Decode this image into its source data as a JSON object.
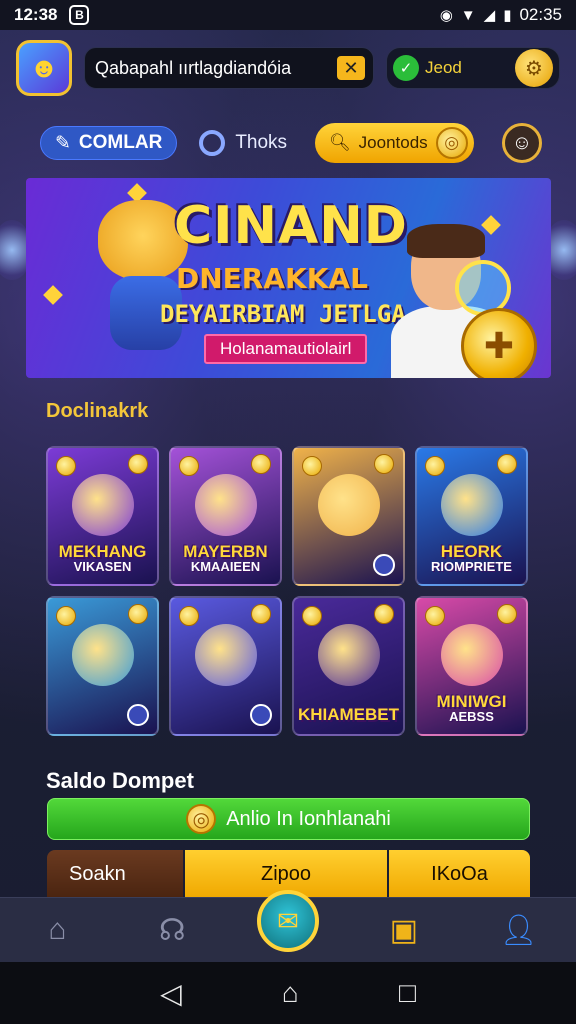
{
  "status_bar": {
    "time": "12:38",
    "notif": "B",
    "clock": "02:35"
  },
  "header": {
    "search_value": "Qabapahl ıırtlagdiandóia",
    "balance_label": "Jeod"
  },
  "subnav": {
    "komlar_label": "COMLAR",
    "thoks_label": "Thoks",
    "join_label": "Joontods"
  },
  "hero": {
    "title": "CINAND",
    "subtitle": "DNERAKKAL",
    "subtitle2": "DEYAIRBIAM JETLGA",
    "tag": "Holanamautiolairl"
  },
  "games_section": {
    "title": "Doclinakrk",
    "games": [
      {
        "l1": "MEKHANG",
        "l2": "VIKASEN",
        "theme": "#7c3bd6"
      },
      {
        "l1": "MAYERBN",
        "l2": "KMAAIEEN",
        "theme": "#a452d8"
      },
      {
        "l1": "",
        "l2": "",
        "theme": "#f0b24a"
      },
      {
        "l1": "HEORK",
        "l2": "RIOMPRIETE",
        "theme": "#2a7ae8"
      },
      {
        "l1": "",
        "l2": "",
        "theme": "#3a9ad8"
      },
      {
        "l1": "",
        "l2": "",
        "theme": "#5a5ae0"
      },
      {
        "l1": "KHIAMEBET",
        "l2": "",
        "theme": "#4a2a9a"
      },
      {
        "l1": "MINIWGI",
        "l2": "AEBSS",
        "theme": "#d84aa8"
      }
    ]
  },
  "wallet": {
    "title": "Saldo Dompet",
    "button_label": "Anlio In Ionhlanahi",
    "tabs": [
      "Soakn",
      "Zipoo",
      "IKoOa"
    ]
  },
  "colors": {
    "accent_yellow": "#f3c63a",
    "accent_green": "#2bbd3a",
    "accent_blue": "#2f58c5"
  }
}
